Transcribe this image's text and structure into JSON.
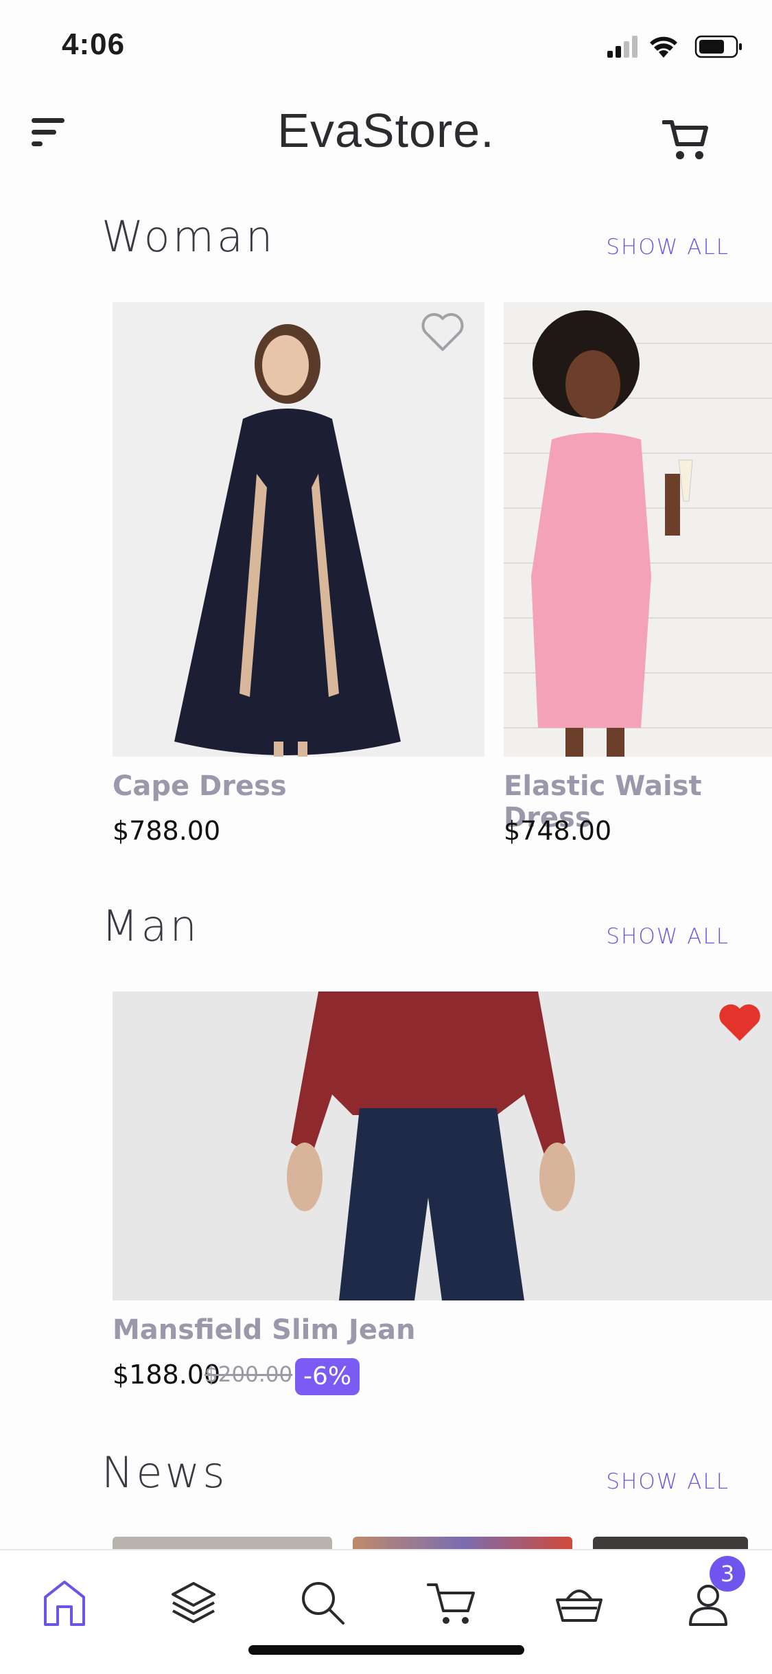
{
  "status": {
    "time": "4:06"
  },
  "header": {
    "brand": "EvaStore."
  },
  "sections": {
    "woman": {
      "title": "Woman",
      "show_all": "SHOW ALL",
      "products": [
        {
          "name": "Cape Dress",
          "price": "$788.00",
          "favorited": false
        },
        {
          "name": "Elastic Waist Dress",
          "price": "$748.00"
        }
      ]
    },
    "man": {
      "title": "Man",
      "show_all": "SHOW ALL",
      "products": [
        {
          "name": "Mansfield Slim Jean",
          "price": "$188.00",
          "old_price": "$200.00",
          "discount": "-6%",
          "favorited": true
        }
      ]
    },
    "news": {
      "title": "News",
      "show_all": "SHOW ALL"
    }
  },
  "tabbar": {
    "items": [
      "home-icon",
      "layers-icon",
      "search-icon",
      "cart-icon",
      "basket-icon",
      "profile-icon"
    ],
    "active": "home-icon",
    "notification_count": "3"
  },
  "colors": {
    "accent": "#6a55e6",
    "badge": "#7a5cf5",
    "favorite": "#e4332b"
  }
}
